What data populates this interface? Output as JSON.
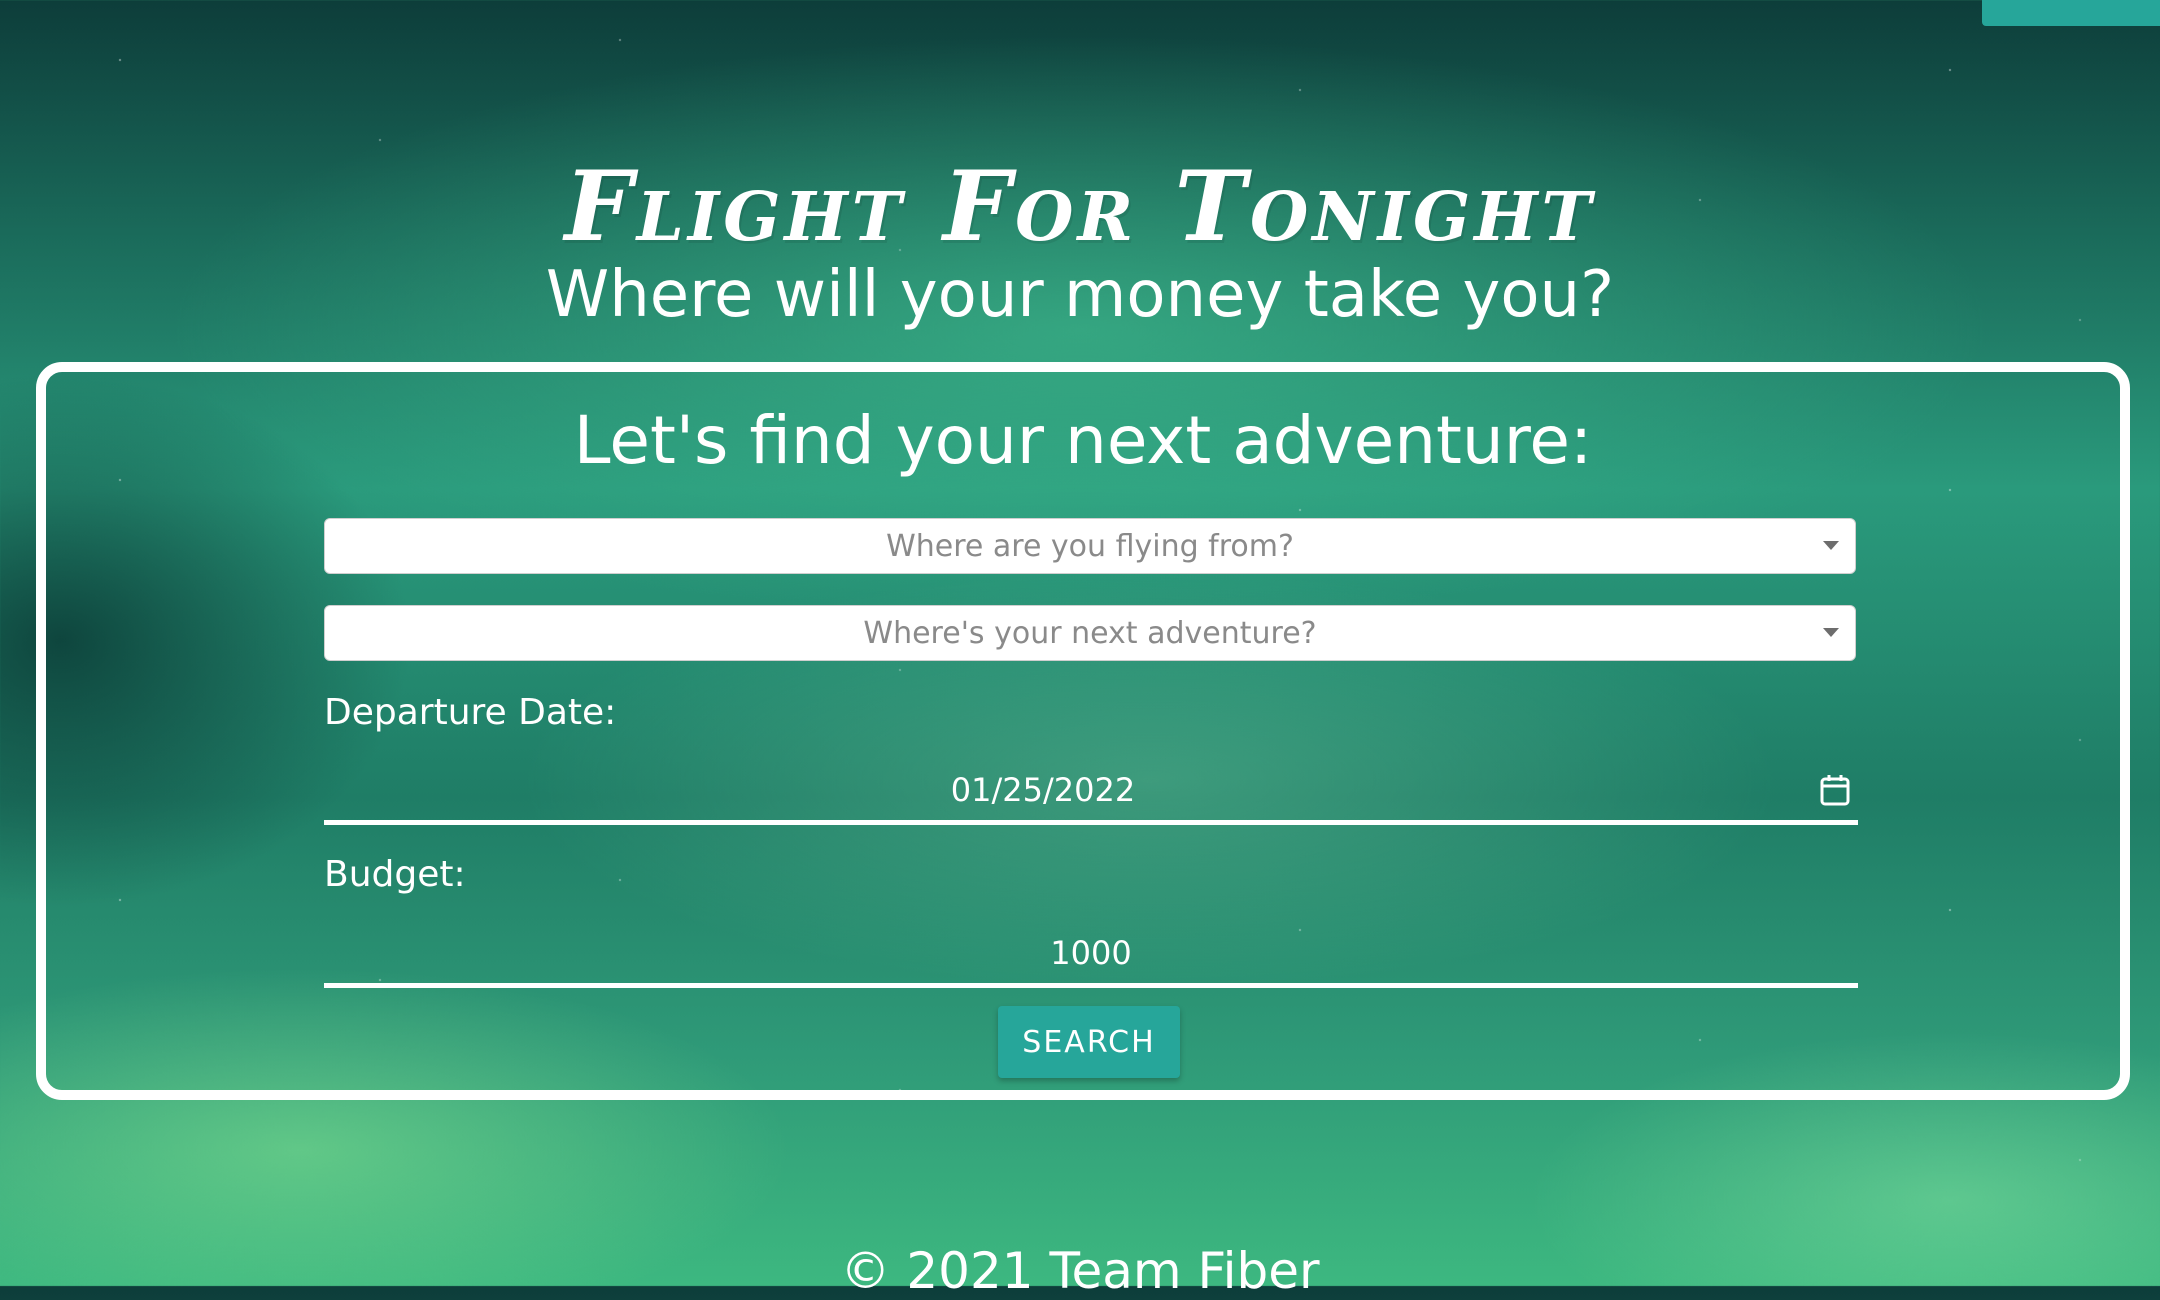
{
  "header": {
    "title": "Flight For Tonight",
    "tagline": "Where will your money take you?"
  },
  "search_form": {
    "heading": "Let's find your next adventure:",
    "origin": {
      "placeholder": "Where are you flying from?",
      "value": ""
    },
    "destination": {
      "placeholder": "Where's your next adventure?",
      "value": ""
    },
    "departure_label": "Departure Date:",
    "departure_value": "01/25/2022",
    "budget_label": "Budget:",
    "budget_value": "1000",
    "search_label": "SEARCH"
  },
  "footer": {
    "text": "© 2021 Team Fiber"
  },
  "icons": {
    "calendar": "calendar-icon",
    "dropdown": "chevron-down-icon"
  },
  "colors": {
    "accent": "#26a69a",
    "card_border": "#ffffff",
    "text": "#ffffff"
  }
}
